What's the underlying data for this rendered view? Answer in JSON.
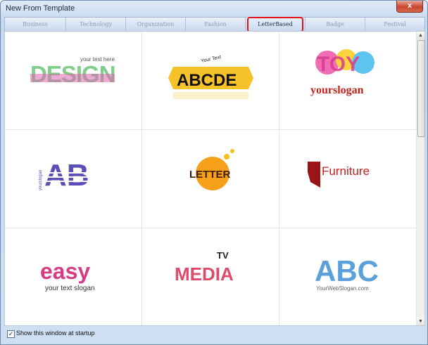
{
  "window": {
    "title": "New From Template",
    "close_glyph": "x"
  },
  "tabs": [
    {
      "label": "Business"
    },
    {
      "label": "Technology"
    },
    {
      "label": "Organization"
    },
    {
      "label": "Fashion"
    },
    {
      "label": "LetterBased",
      "active": true
    },
    {
      "label": "Badge"
    },
    {
      "label": "Festival"
    }
  ],
  "templates": [
    {
      "name": "DESIGN",
      "tagline": "your text here"
    },
    {
      "name": "ABCDE",
      "tagline": "Your Text"
    },
    {
      "name": "TOY",
      "tagline": "yourslogan"
    },
    {
      "name": "AB",
      "tagline": "yourslogan"
    },
    {
      "name": "LETTER",
      "tagline": ""
    },
    {
      "name": "Furniture",
      "tagline": ""
    },
    {
      "name": "easy",
      "tagline": "your text slogan"
    },
    {
      "name": "MEDIA",
      "tagline": "TV"
    },
    {
      "name": "ABC",
      "tagline": "YourWebSlogan.com"
    }
  ],
  "footer": {
    "checkbox_label": "Show this window at startup",
    "checked": true,
    "check_glyph": "✓"
  },
  "scrollbar": {
    "up_glyph": "▲",
    "down_glyph": "▼"
  }
}
